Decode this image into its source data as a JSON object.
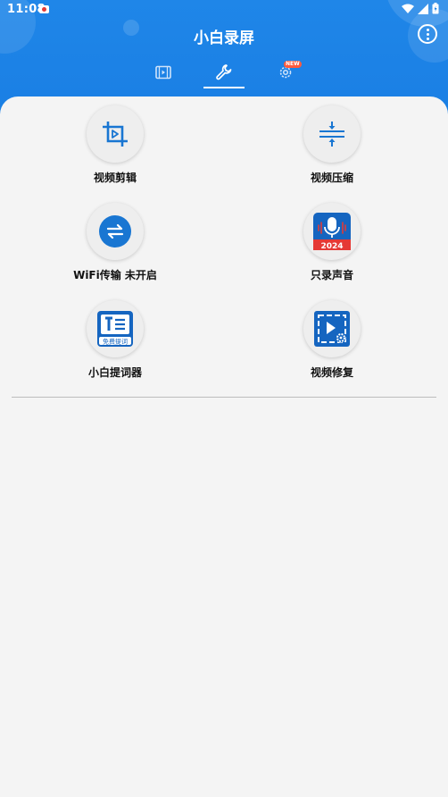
{
  "status": {
    "time": "11:08"
  },
  "header": {
    "title": "小白录屏",
    "tabs": [
      {
        "name": "videos",
        "icon": "film-icon"
      },
      {
        "name": "tools",
        "icon": "wrench-icon",
        "active": true
      },
      {
        "name": "settings",
        "icon": "gear-icon",
        "badge": "NEW"
      }
    ]
  },
  "tools": [
    {
      "label": "视频剪辑",
      "icon": "crop-icon"
    },
    {
      "label": "视频压缩",
      "icon": "compress-icon"
    },
    {
      "label": "WiFi传输 未开启",
      "icon": "transfer-icon"
    },
    {
      "label": "只录声音",
      "icon": "microphone-icon",
      "icon_text": "2024"
    },
    {
      "label": "小白提词器",
      "icon": "teleprompter-icon",
      "icon_text": "免费提词"
    },
    {
      "label": "视频修复",
      "icon": "video-repair-icon"
    }
  ],
  "colors": {
    "header_blue": "#1a7fe4",
    "icon_blue": "#1976d2",
    "badge_red": "#ff5a3c"
  }
}
